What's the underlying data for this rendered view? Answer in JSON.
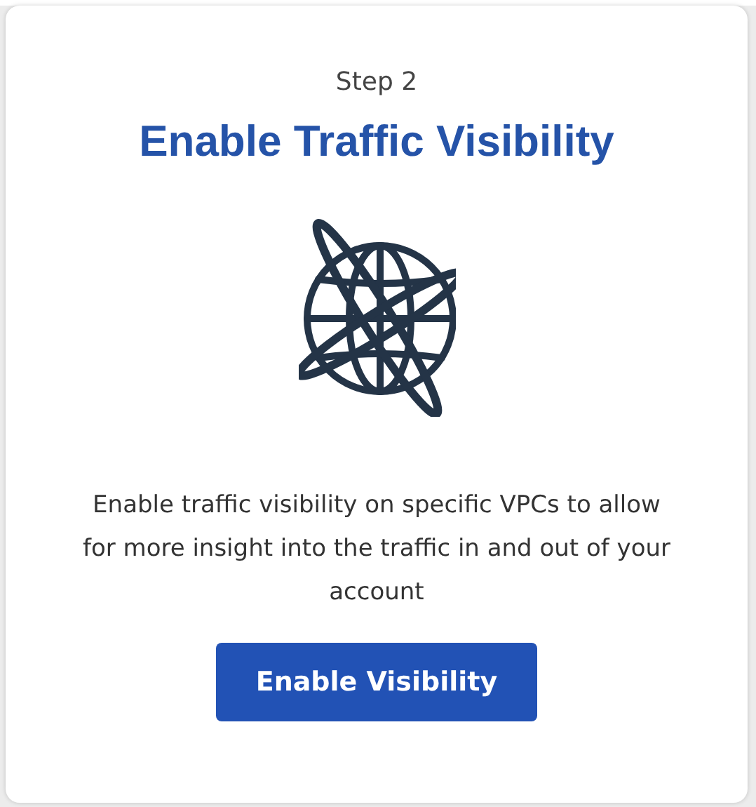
{
  "card": {
    "step": "Step 2",
    "title": "Enable Traffic Visibility",
    "description": "Enable traffic visibility on specific VPCs to allow for more insight into the traffic in and out of your account",
    "button": "Enable Visibility"
  }
}
